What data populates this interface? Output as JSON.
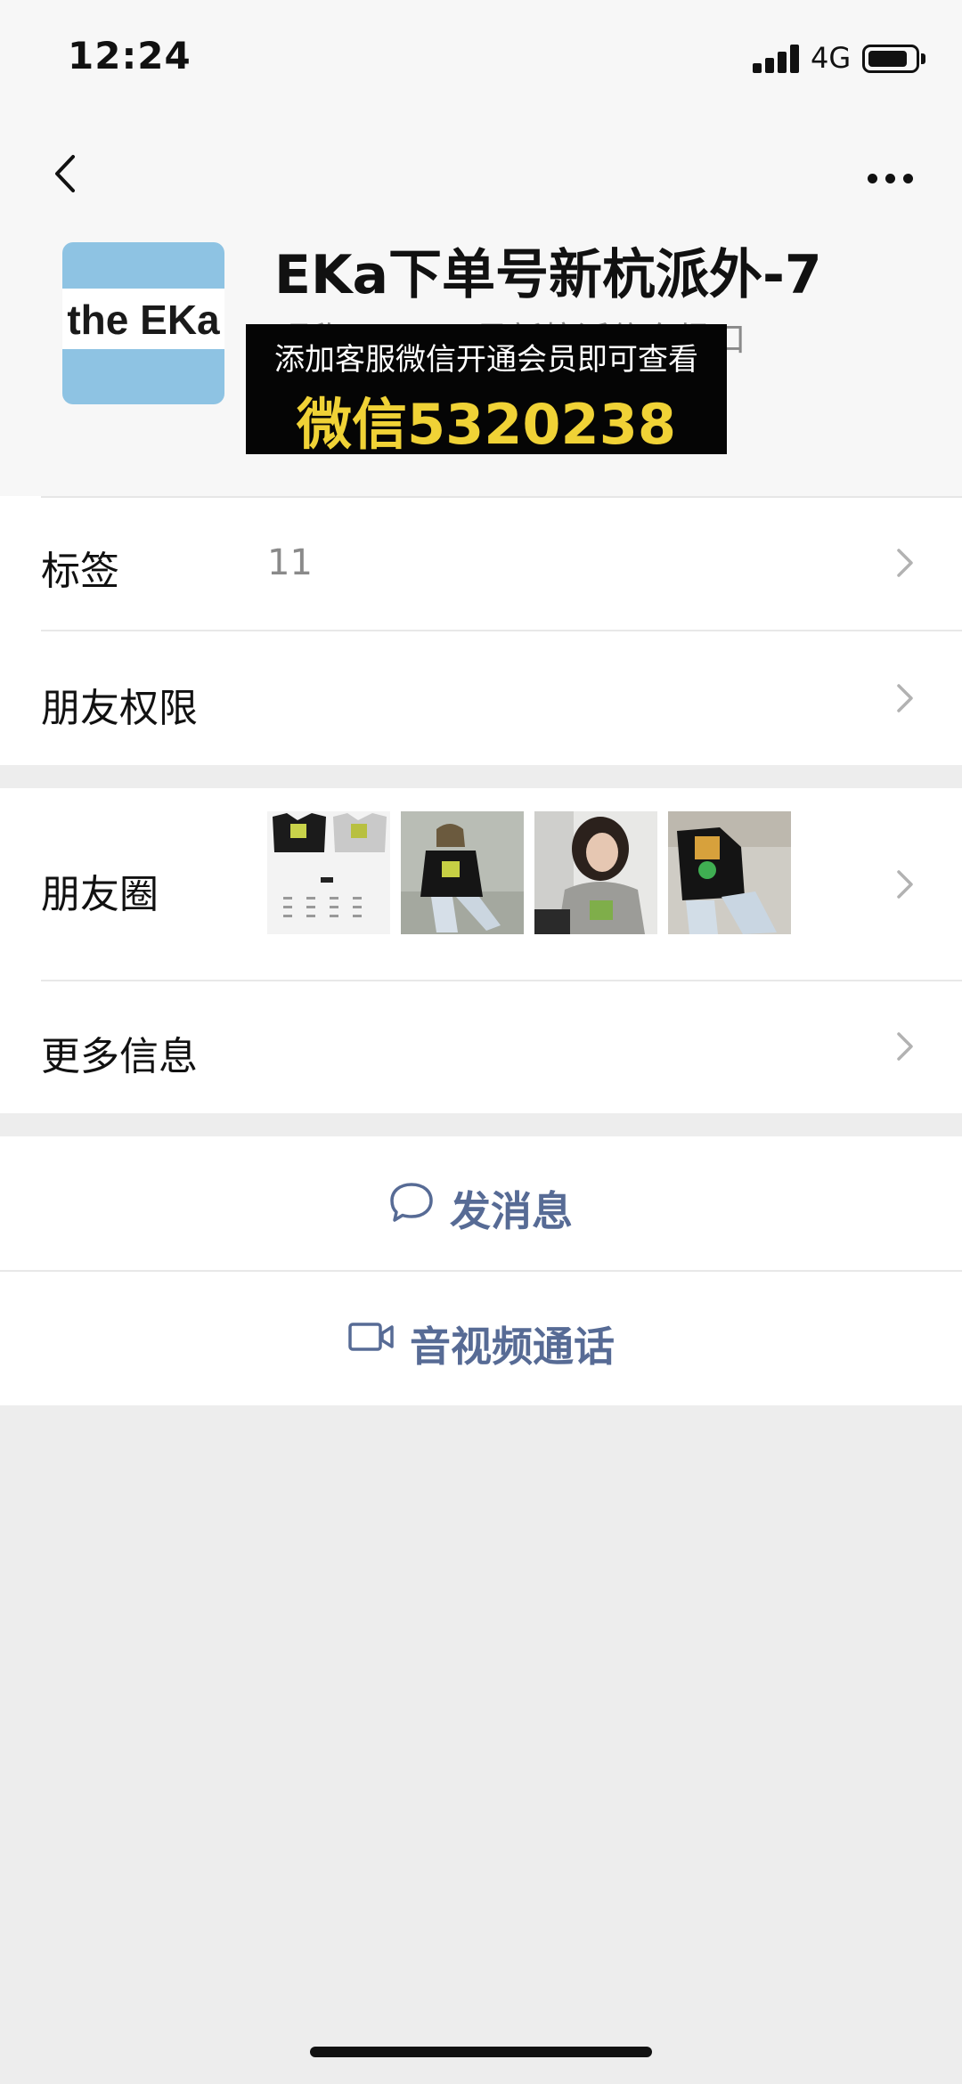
{
  "status_bar": {
    "time": "12:24",
    "network": "4G",
    "battery_level": 0.85
  },
  "nav": {
    "back_icon": "chevron-left-icon",
    "more_icon": "more-dots-icon"
  },
  "profile": {
    "avatar_text": "the EKa",
    "avatar_color": "#8ec3e3",
    "display_name": "EKa下单号新杭派外-7",
    "nickname": "昵称：EK...8号新杭派信东场口",
    "overlay_line1": "添加客服微信开通会员即可查看",
    "overlay_line2": "微信5320238",
    "overlay_accent": "#f0d236"
  },
  "rows": {
    "tags": {
      "label": "标签",
      "value": "11"
    },
    "permissions": {
      "label": "朋友权限"
    },
    "moments": {
      "label": "朋友圈"
    },
    "more_info": {
      "label": "更多信息"
    }
  },
  "actions": {
    "message": {
      "label": "发消息",
      "icon": "chat-bubble-icon"
    },
    "call": {
      "label": "音视频通话",
      "icon": "video-camera-icon"
    },
    "link_color": "#576b95"
  }
}
